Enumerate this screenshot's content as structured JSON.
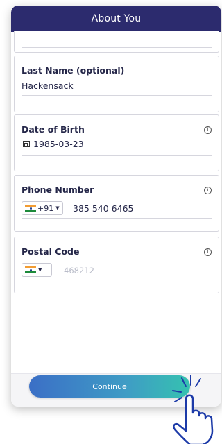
{
  "header": {
    "title": "About You"
  },
  "last_name": {
    "label": "Last Name (optional)",
    "value": "Hackensack"
  },
  "dob": {
    "label": "Date of Birth",
    "value": "1985-03-23",
    "info": "i"
  },
  "phone": {
    "label": "Phone Number",
    "dial_code": "+91",
    "value": "385 540 6465",
    "info": "i"
  },
  "postal": {
    "label": "Postal Code",
    "placeholder": "468212",
    "info": "i"
  },
  "continue_label": "Continue",
  "icons": {
    "calendar": "calendar-icon",
    "info": "info-icon",
    "flag": "india-flag-icon",
    "pointer": "hand-pointer-icon"
  }
}
